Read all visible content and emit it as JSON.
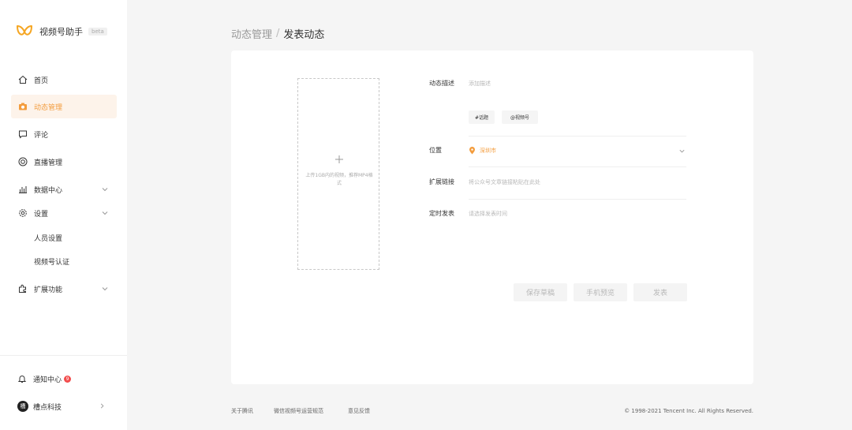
{
  "app": {
    "name": "视频号助手",
    "badge": "beta"
  },
  "sidebar": {
    "items": [
      {
        "label": "首页"
      },
      {
        "label": "动态管理"
      },
      {
        "label": "评论"
      },
      {
        "label": "直播管理"
      },
      {
        "label": "数据中心"
      },
      {
        "label": "设置"
      },
      {
        "label": "扩展功能"
      }
    ],
    "subitems": [
      {
        "label": "人员设置"
      },
      {
        "label": "视频号认证"
      }
    ],
    "notify": {
      "label": "通知中心",
      "count": "9"
    },
    "account": {
      "avatar_text": "槽",
      "name": "槽点科技"
    }
  },
  "breadcrumb": {
    "parent": "动态管理",
    "separator": "/",
    "current": "发表动态"
  },
  "form": {
    "upload_hint": "上传1GB内的视频，推荐MP4格式",
    "description": {
      "label": "动态描述",
      "placeholder": "添加描述"
    },
    "tags": [
      "#话题",
      "@视频号"
    ],
    "location": {
      "label": "位置",
      "value": "深圳市"
    },
    "link": {
      "label": "扩展链接",
      "placeholder": "将公众号文章链接粘贴在此处"
    },
    "schedule": {
      "label": "定时发表",
      "placeholder": "请选择发表时间"
    }
  },
  "actions": {
    "save_draft": "保存草稿",
    "preview": "手机预览",
    "publish": "发表"
  },
  "footer": {
    "links": [
      "关于腾讯",
      "微信视频号运营规范",
      "意见反馈"
    ],
    "copyright": "© 1998-2021 Tencent Inc. All Rights Reserved."
  },
  "colors": {
    "accent": "#f39c3d",
    "active_bg": "#fdf3ea",
    "badge": "#f24c4c"
  }
}
